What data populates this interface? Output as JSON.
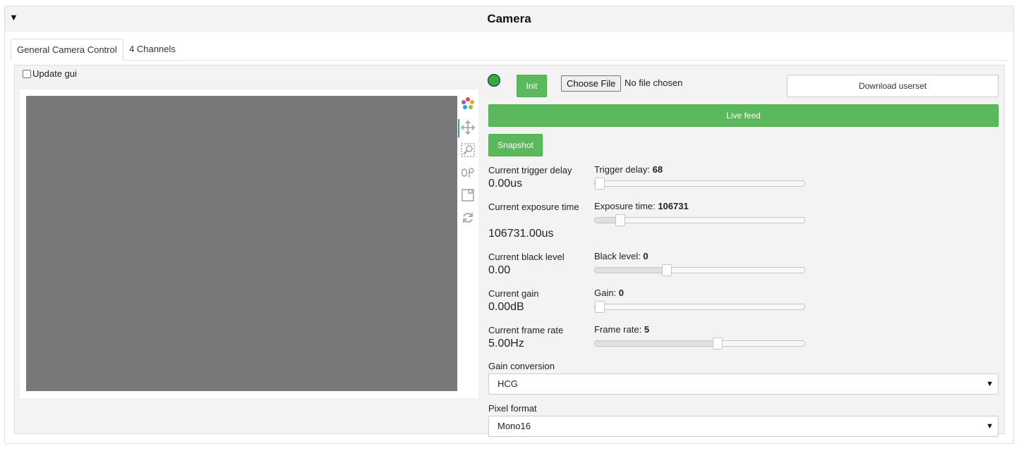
{
  "panel": {
    "title": "Camera",
    "collapse_icon": "▼"
  },
  "tabs": [
    {
      "label": "General Camera Control",
      "active": true
    },
    {
      "label": "4 Channels",
      "active": false
    }
  ],
  "update_gui": {
    "label": "Update gui",
    "checked": false
  },
  "plot": {
    "modebar_icons": [
      "plotly-logo-icon",
      "pan-icon",
      "zoom-icon",
      "toggle-spikelines-icon",
      "download-image-icon",
      "reset-axes-icon"
    ]
  },
  "status_led": {
    "color": "#33aa44"
  },
  "buttons": {
    "init": "Init",
    "choose_file": "Choose File",
    "file_status": "No file chosen",
    "download": "Download userset",
    "live_feed": "Live feed",
    "snapshot": "Snapshot"
  },
  "controls": [
    {
      "current_label": "Current trigger delay",
      "current_value": "0.00us",
      "slider_label": "Trigger delay:",
      "slider_value": "68",
      "position": 0.0
    },
    {
      "current_label": "Current exposure time",
      "current_value": "106731.00us",
      "slider_label": "Exposure time:",
      "slider_value": "106731",
      "position": 0.1
    },
    {
      "current_label": "Current black level",
      "current_value": "0.00",
      "slider_label": "Black level:",
      "slider_value": "0",
      "position": 0.335
    },
    {
      "current_label": "Current gain",
      "current_value": "0.00dB",
      "slider_label": "Gain:",
      "slider_value": "0",
      "position": 0.0
    },
    {
      "current_label": "Current frame rate",
      "current_value": "5.00Hz",
      "slider_label": "Frame rate:",
      "slider_value": "5",
      "position": 0.585
    }
  ],
  "gain_conversion": {
    "label": "Gain conversion",
    "value": "HCG"
  },
  "pixel_format": {
    "label": "Pixel format",
    "value": "Mono16"
  },
  "colors": {
    "green": "#5cb85c",
    "image_gray": "#787878",
    "accent": "#3c95c8"
  }
}
